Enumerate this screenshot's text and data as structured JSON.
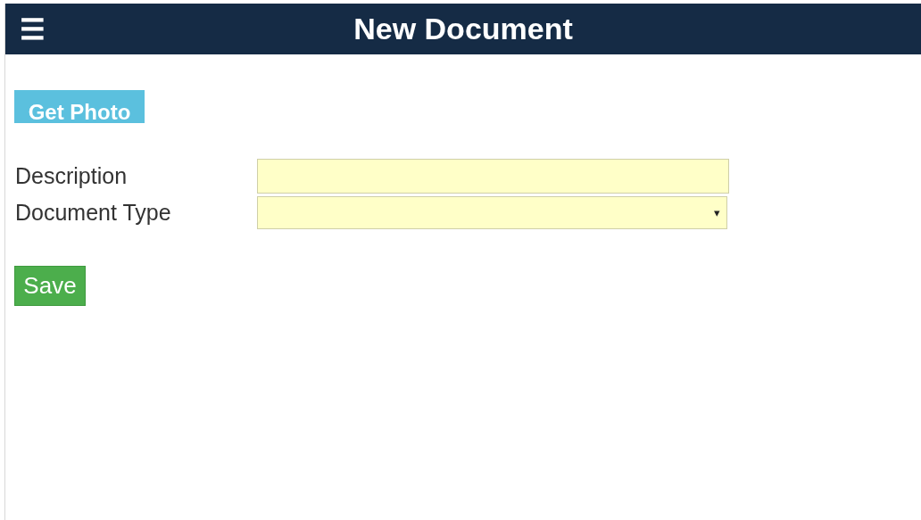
{
  "header": {
    "menu_icon": "☰",
    "title": "New Document"
  },
  "photo_button": {
    "label": "Get Photo"
  },
  "fields": [
    {
      "kind": "text",
      "label": "Description"
    },
    {
      "kind": "select",
      "label": "Document Type",
      "arrow": "▾"
    }
  ],
  "save_button": {
    "label": "Save"
  }
}
